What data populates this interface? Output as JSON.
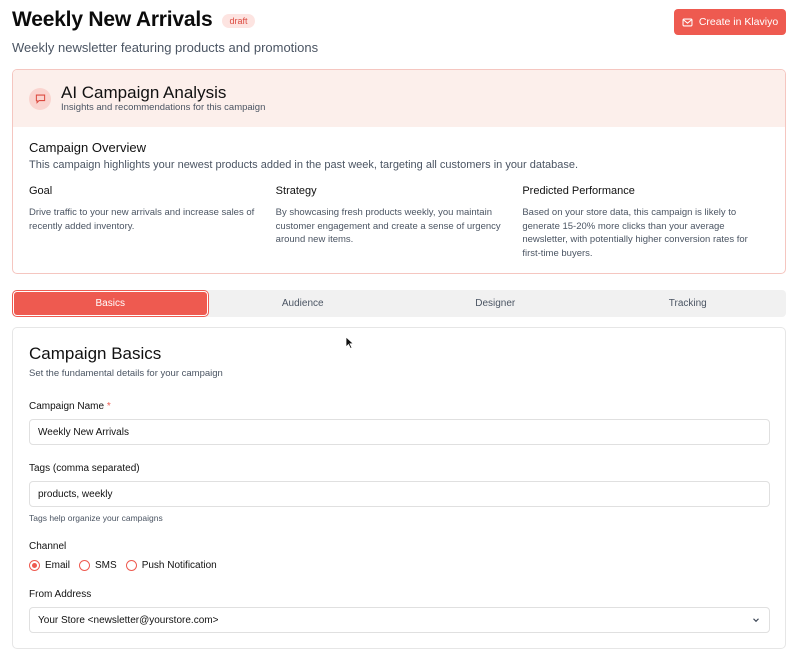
{
  "header": {
    "title": "Weekly New Arrivals",
    "status": "draft",
    "subtitle": "Weekly newsletter featuring products and promotions",
    "create_button": "Create in Klaviyo",
    "create_button_icon": "mail-icon",
    "accent_color": "#ee5a50"
  },
  "analysis": {
    "icon": "chat-icon",
    "title": "AI Campaign Analysis",
    "subtitle": "Insights and recommendations for this campaign",
    "overview_title": "Campaign Overview",
    "overview_text": "This campaign highlights your newest products added in the past week, targeting all customers in your database.",
    "goal_title": "Goal",
    "goal_text": "Drive traffic to your new arrivals and increase sales of recently added inventory.",
    "strategy_title": "Strategy",
    "strategy_text": "By showcasing fresh products weekly, you maintain customer engagement and create a sense of urgency around new items.",
    "performance_title": "Predicted Performance",
    "performance_text": "Based on your store data, this campaign is likely to generate 15-20% more clicks than your average newsletter, with potentially higher conversion rates for first-time buyers."
  },
  "tabs": [
    {
      "label": "Basics",
      "active": true
    },
    {
      "label": "Audience",
      "active": false
    },
    {
      "label": "Designer",
      "active": false
    },
    {
      "label": "Tracking",
      "active": false
    }
  ],
  "basics": {
    "title": "Campaign Basics",
    "subtitle": "Set the fundamental details for your campaign",
    "name_label": "Campaign Name",
    "required_mark": "*",
    "name_value": "Weekly New Arrivals",
    "tags_label": "Tags (comma separated)",
    "tags_value": "products, weekly",
    "tags_help": "Tags help organize your campaigns",
    "channel_label": "Channel",
    "channels": [
      {
        "label": "Email",
        "checked": true
      },
      {
        "label": "SMS",
        "checked": false
      },
      {
        "label": "Push Notification",
        "checked": false
      }
    ],
    "from_label": "From Address",
    "from_value": "Your Store <newsletter@yourstore.com>"
  }
}
